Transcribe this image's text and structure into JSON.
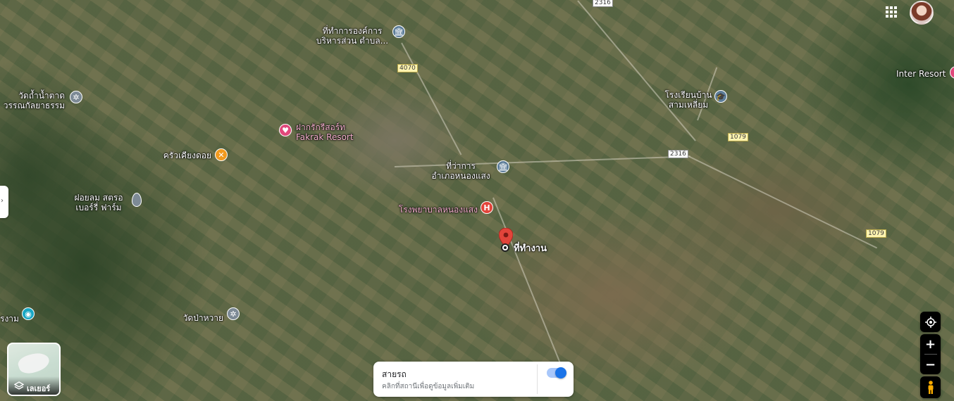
{
  "map": {
    "places": [
      {
        "id": "sao",
        "name_line1": "ที่ทำการองค์การ",
        "name_line2": "บริหารส่วน ตำบล...",
        "icon": "government-icon"
      },
      {
        "id": "wat-tham",
        "name_line1": "วัดถ้ำน้ำตาด",
        "name_line2": "วรรณกัลยาธรรม",
        "icon": "temple-icon"
      },
      {
        "id": "fakrak",
        "name_line1": "ฝากรักรีสอร์ท",
        "name_line2": "Fakrak Resort",
        "icon": "hotel-icon"
      },
      {
        "id": "krua",
        "name_line1": "ครัวเคียงดอย",
        "name_line2": "",
        "icon": "restaurant-icon"
      },
      {
        "id": "district-office",
        "name_line1": "ที่ว่าการ",
        "name_line2": "อำเภอหนองแสง",
        "icon": "government-icon"
      },
      {
        "id": "hospital",
        "name_line1": "โรงพยาบาลหนองแสง",
        "name_line2": "",
        "icon": "hospital-icon"
      },
      {
        "id": "farm",
        "name_line1": "ฝอยลม สตรอ",
        "name_line2": "เบอร์รี่ ฟาร์ม",
        "icon": "pin-icon"
      },
      {
        "id": "work",
        "name_line1": "ที่ทำงาน",
        "name_line2": "",
        "icon": "workplace-pin-icon"
      },
      {
        "id": "school",
        "name_line1": "โรงเรียนบ้าน",
        "name_line2": "สามเหลี่ยม",
        "icon": "school-icon"
      },
      {
        "id": "inter",
        "name_line1": "Inter Resort",
        "name_line2": "",
        "icon": "hotel-icon"
      },
      {
        "id": "wat-pa",
        "name_line1": "วัดป่าหวาย",
        "name_line2": "",
        "icon": "temple-icon"
      },
      {
        "id": "edge-cam",
        "name_line1": "รงาม",
        "name_line2": "",
        "icon": "camera-icon"
      }
    ],
    "road_shields": [
      "2316",
      "4070",
      "1079",
      "2316",
      "1079"
    ]
  },
  "layers_button": {
    "label": "เลเยอร์",
    "icon": "layers-icon"
  },
  "traffic_panel": {
    "title": "สายรถ",
    "subtitle": "คลิกที่สถานีเพื่อดูข้อมูลเพิ่มเติม",
    "toggle_on": true
  },
  "controls": {
    "zoom_in": "+",
    "zoom_out": "−"
  },
  "colors": {
    "accent": "#1a73e8",
    "pin_red": "#e2443a",
    "hospital": "#e2443a",
    "hotel": "#e0487b",
    "restaurant": "#f29a1e"
  }
}
